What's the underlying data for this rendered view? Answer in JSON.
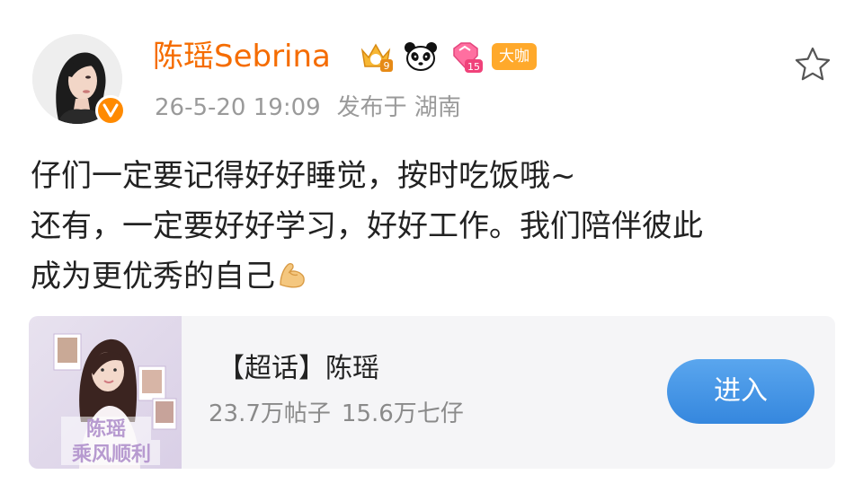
{
  "post": {
    "author": {
      "name": "陈瑶Sebrina",
      "name_color": "#f56c00",
      "badges": [
        "crown-level-9-icon",
        "panda-icon",
        "heart-level-15-icon"
      ],
      "badge_level_crown": "9",
      "badge_level_heart": "15",
      "tag": "大咖",
      "verified": true
    },
    "meta": {
      "date": "26-5-20 19:09",
      "location": "发布于 湖南"
    },
    "text_lines": [
      "仔们一定要记得好好睡觉，按时吃饭哦~",
      "还有，一定要好好学习，好好工作。我们陪伴彼此",
      "成为更优秀的自己"
    ],
    "emoji": "flexed-biceps-icon"
  },
  "topic_card": {
    "title": "【超话】陈瑶",
    "posts_count": "23.7万帖子",
    "followers_count": "15.6万七仔",
    "enter_label": "进入",
    "enter_color": "#3d8fe0",
    "cover_text": "陈瑶乘风顺利"
  },
  "colors": {
    "accent_orange": "#f56c00",
    "meta_gray": "#9a9a9a",
    "body_text": "#222222",
    "card_bg": "#f5f5f7"
  }
}
